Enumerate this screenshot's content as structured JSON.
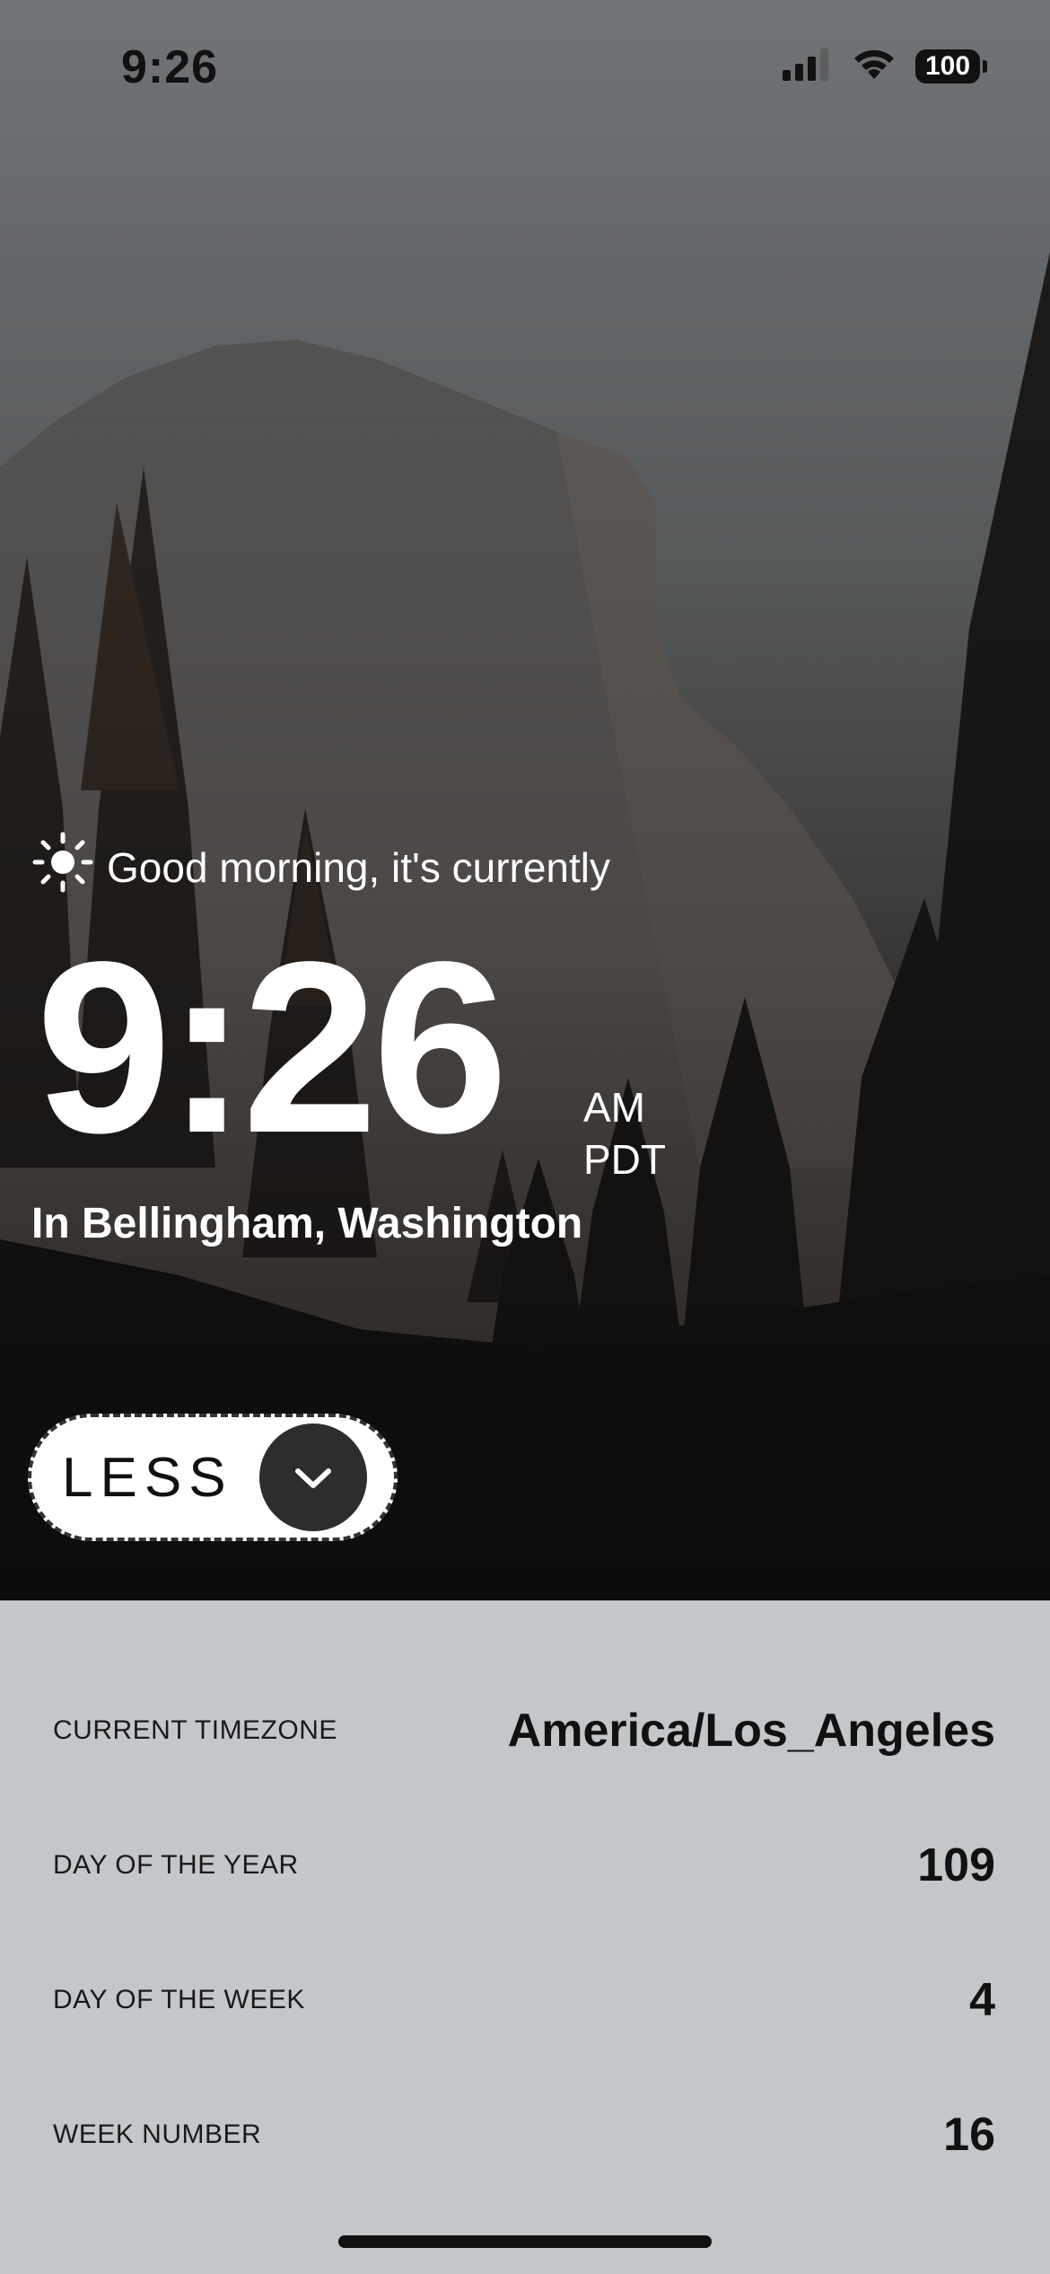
{
  "status_bar": {
    "time": "9:26",
    "battery": "100",
    "icons": [
      "cellular-signal-icon",
      "wifi-icon",
      "battery-icon"
    ]
  },
  "greeting": {
    "icon": "sun-icon",
    "text": "Good morning, it's currently"
  },
  "clock": {
    "time": "9:26",
    "meridiem": "AM",
    "timezone_abbr": "PDT"
  },
  "location": {
    "text": "In Bellingham, Washington"
  },
  "toggle_button": {
    "label": "LESS",
    "icon": "chevron-down-icon"
  },
  "details": [
    {
      "label": "CURRENT TIMEZONE",
      "value": "America/Los_Angeles"
    },
    {
      "label": "DAY OF THE YEAR",
      "value": "109"
    },
    {
      "label": "DAY OF THE WEEK",
      "value": "4"
    },
    {
      "label": "WEEK NUMBER",
      "value": "16"
    }
  ],
  "colors": {
    "panel_background": "#c4c7ca",
    "button_background": "#ffffff",
    "button_icon_circle": "#2d2d2d",
    "text_light": "#ffffff",
    "text_dark": "#111111"
  }
}
